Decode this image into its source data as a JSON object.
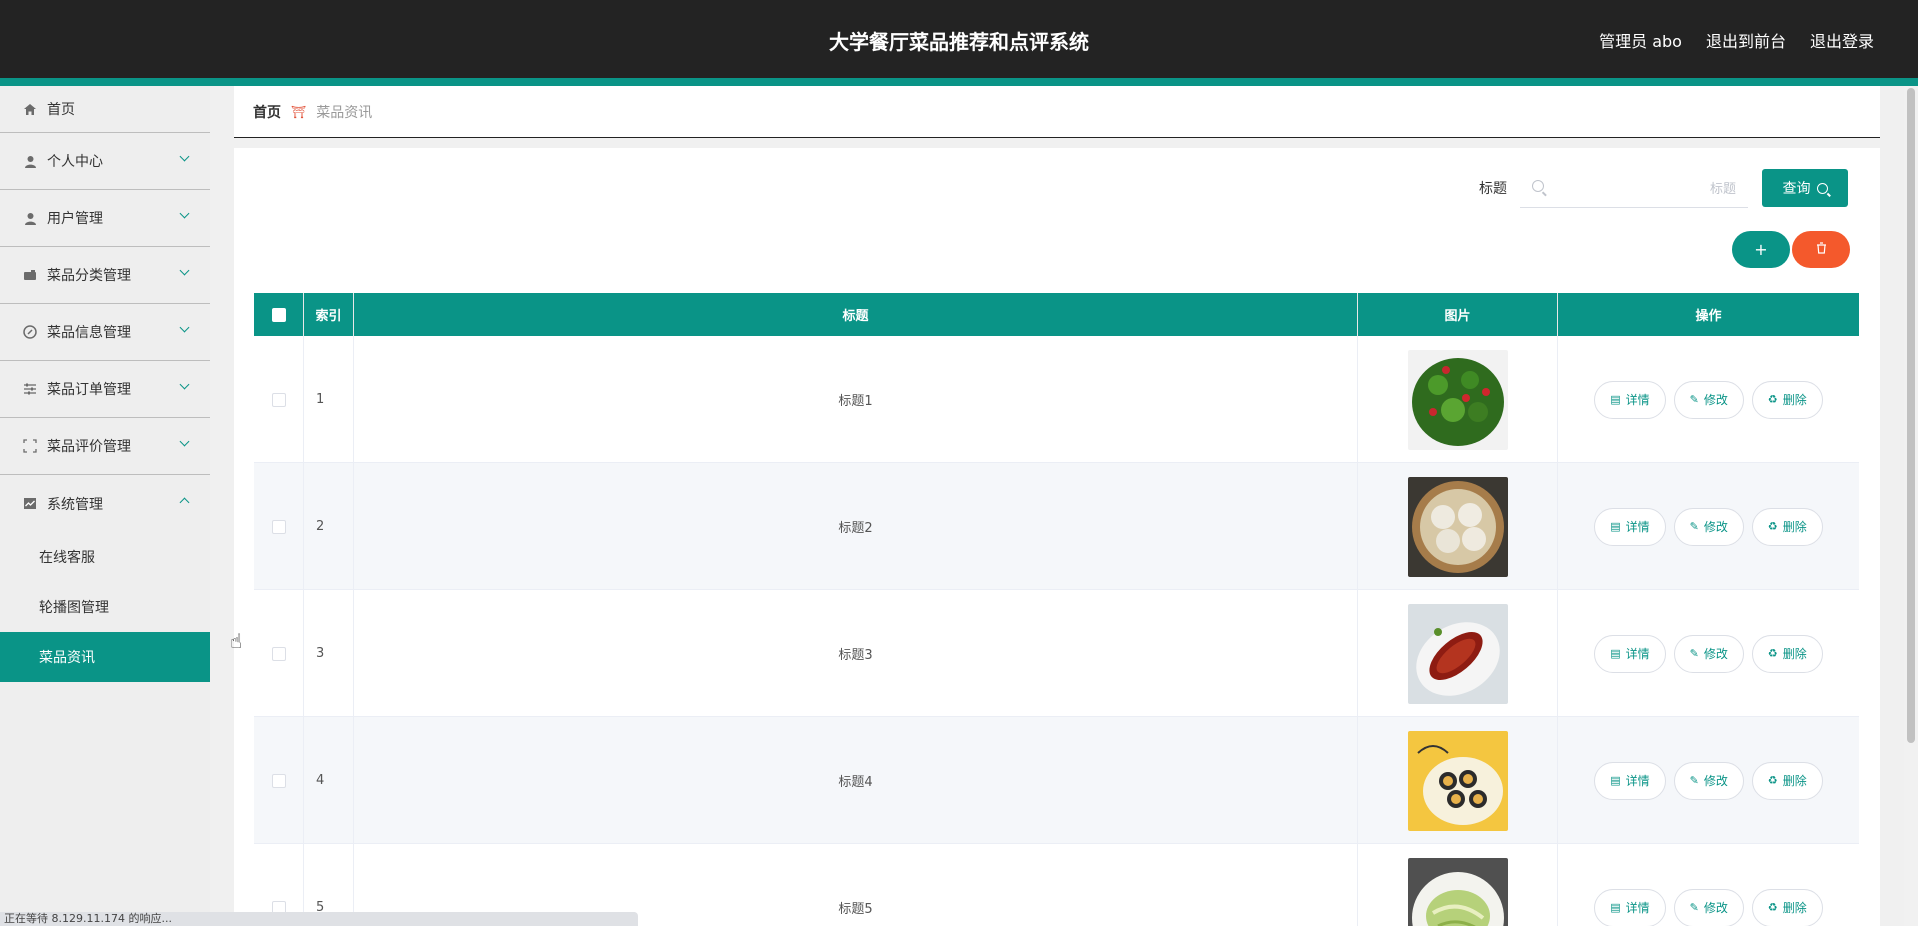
{
  "header": {
    "title": "大学餐厅菜品推荐和点评系统",
    "admin_label": "管理员 abo",
    "exit_front": "退出到前台",
    "logout": "退出登录"
  },
  "sidebar": {
    "items": [
      {
        "label": "首页",
        "icon": "home-icon"
      },
      {
        "label": "个人中心",
        "icon": "user-icon"
      },
      {
        "label": "用户管理",
        "icon": "user-icon"
      },
      {
        "label": "菜品分类管理",
        "icon": "wallet-icon"
      },
      {
        "label": "菜品信息管理",
        "icon": "compass-icon"
      },
      {
        "label": "菜品订单管理",
        "icon": "sliders-icon"
      },
      {
        "label": "菜品评价管理",
        "icon": "fullscreen-icon"
      },
      {
        "label": "系统管理",
        "icon": "chart-icon"
      }
    ],
    "sub_items": [
      {
        "label": "在线客服"
      },
      {
        "label": "轮播图管理"
      },
      {
        "label": "菜品资讯"
      }
    ]
  },
  "breadcrumb": {
    "home": "首页",
    "current": "菜品资讯"
  },
  "search": {
    "label": "标题",
    "placeholder": "标题",
    "button": "查询"
  },
  "actions": {
    "add": "+"
  },
  "table": {
    "headers": {
      "index": "索引",
      "title": "标题",
      "image": "图片",
      "ops": "操作"
    },
    "ops": {
      "detail": "详情",
      "edit": "修改",
      "delete": "删除"
    },
    "rows": [
      {
        "index": "1",
        "title": "标题1"
      },
      {
        "index": "2",
        "title": "标题2"
      },
      {
        "index": "3",
        "title": "标题3"
      },
      {
        "index": "4",
        "title": "标题4"
      },
      {
        "index": "5",
        "title": "标题5"
      }
    ]
  },
  "status_bar": "正在等待 8.129.11.174 的响应...",
  "colors": {
    "primary": "#0a9487",
    "danger": "#f4592c",
    "header_bg": "#232323"
  }
}
